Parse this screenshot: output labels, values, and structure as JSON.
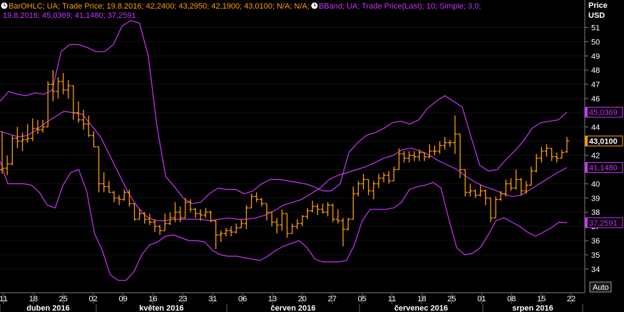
{
  "legend": {
    "ohlc": {
      "prefix": "BarOHLC; UA; Trade Price; 19.8.2016; 42,2400; 43,2950; 42,1900; 43,0100; N/A; N/A;",
      "color": "#ff9e00",
      "icon": "clock-icon"
    },
    "bband": {
      "line1": "BBand; UA; Trade Price(Last);  10; Simple; 3,0;",
      "line2": "19.8.2016; 45,0369; 41,1480; 37,2591",
      "color": "#cc33ff",
      "icon": "clock-icon"
    }
  },
  "axis": {
    "header_line1": "Price",
    "header_line2": "USD",
    "auto_label": "Auto"
  },
  "tags": [
    {
      "label": "45,0369",
      "value": 45.0369,
      "color": "#cc33ff",
      "text": "#cc33ff"
    },
    {
      "label": "43,0100",
      "value": 43.01,
      "color": "#ff9e00",
      "text": "#ffffff"
    },
    {
      "label": "41,1480",
      "value": 41.148,
      "color": "#cc33ff",
      "text": "#cc33ff"
    },
    {
      "label": "37,2591",
      "value": 37.2591,
      "color": "#cc33ff",
      "text": "#cc33ff"
    }
  ],
  "chart_data": {
    "type": "ohlc",
    "ylim": [
      33,
      52
    ],
    "y_ticks": [
      34,
      35,
      36,
      37,
      38,
      39,
      40,
      41,
      42,
      43,
      44,
      45,
      46,
      47,
      48,
      49,
      50,
      51
    ],
    "x_ticks": [
      "11",
      "18",
      "25",
      "02",
      "09",
      "16",
      "23",
      "31",
      "06",
      "13",
      "20",
      "27",
      "05",
      "11",
      "18",
      "25",
      "01",
      "08",
      "15",
      "22"
    ],
    "months": [
      "duben 2016",
      "květen 2016",
      "červen 2016",
      "červenec 2016",
      "srpen 2016"
    ],
    "bars": [
      {
        "o": 41.0,
        "h": 43.7,
        "l": 40.7,
        "c": 41.1
      },
      {
        "o": 41.1,
        "h": 42.0,
        "l": 40.6,
        "c": 41.4
      },
      {
        "o": 41.4,
        "h": 43.4,
        "l": 41.3,
        "c": 43.2
      },
      {
        "o": 43.2,
        "h": 44.0,
        "l": 42.5,
        "c": 43.0
      },
      {
        "o": 43.0,
        "h": 43.6,
        "l": 42.3,
        "c": 43.1
      },
      {
        "o": 43.1,
        "h": 44.2,
        "l": 42.9,
        "c": 43.2
      },
      {
        "o": 43.2,
        "h": 44.6,
        "l": 43.0,
        "c": 43.9
      },
      {
        "o": 43.9,
        "h": 44.5,
        "l": 43.5,
        "c": 43.8
      },
      {
        "o": 43.8,
        "h": 44.5,
        "l": 43.6,
        "c": 44.0
      },
      {
        "o": 44.0,
        "h": 47.2,
        "l": 44.7,
        "c": 47.0
      },
      {
        "o": 47.0,
        "h": 48.0,
        "l": 45.8,
        "c": 46.5
      },
      {
        "o": 46.5,
        "h": 47.5,
        "l": 46.0,
        "c": 47.2
      },
      {
        "o": 47.2,
        "h": 47.8,
        "l": 46.3,
        "c": 46.6
      },
      {
        "o": 46.6,
        "h": 47.3,
        "l": 46.0,
        "c": 46.9
      },
      {
        "o": 46.9,
        "h": 46.1,
        "l": 44.5,
        "c": 45.0
      },
      {
        "o": 45.0,
        "h": 45.8,
        "l": 44.3,
        "c": 44.5
      },
      {
        "o": 44.5,
        "h": 45.2,
        "l": 43.8,
        "c": 44.2
      },
      {
        "o": 44.2,
        "h": 44.8,
        "l": 43.3,
        "c": 43.4
      },
      {
        "o": 43.4,
        "h": 43.7,
        "l": 42.6,
        "c": 42.6
      },
      {
        "o": 42.6,
        "h": 41.6,
        "l": 39.4,
        "c": 40.0
      },
      {
        "o": 40.0,
        "h": 40.8,
        "l": 39.4,
        "c": 39.8
      },
      {
        "o": 39.8,
        "h": 40.2,
        "l": 39.4,
        "c": 39.4
      },
      {
        "o": 39.4,
        "h": 39.5,
        "l": 38.7,
        "c": 39.0
      },
      {
        "o": 39.0,
        "h": 39.2,
        "l": 38.5,
        "c": 38.9
      },
      {
        "o": 38.9,
        "h": 39.6,
        "l": 38.8,
        "c": 39.4
      },
      {
        "o": 39.4,
        "h": 39.6,
        "l": 38.4,
        "c": 38.6
      },
      {
        "o": 38.6,
        "h": 38.6,
        "l": 37.4,
        "c": 37.5
      },
      {
        "o": 37.5,
        "h": 38.2,
        "l": 37.5,
        "c": 37.9
      },
      {
        "o": 37.9,
        "h": 38.0,
        "l": 37.2,
        "c": 37.5
      },
      {
        "o": 37.5,
        "h": 37.9,
        "l": 37.1,
        "c": 37.3
      },
      {
        "o": 37.3,
        "h": 37.5,
        "l": 36.6,
        "c": 37.0
      },
      {
        "o": 37.0,
        "h": 37.1,
        "l": 36.4,
        "c": 36.7
      },
      {
        "o": 36.7,
        "h": 37.9,
        "l": 36.8,
        "c": 37.2
      },
      {
        "o": 37.2,
        "h": 38.0,
        "l": 37.1,
        "c": 37.6
      },
      {
        "o": 37.6,
        "h": 38.7,
        "l": 37.3,
        "c": 38.0
      },
      {
        "o": 38.0,
        "h": 38.4,
        "l": 37.3,
        "c": 37.6
      },
      {
        "o": 37.6,
        "h": 39.0,
        "l": 37.6,
        "c": 38.7
      },
      {
        "o": 38.7,
        "h": 38.9,
        "l": 38.0,
        "c": 38.2
      },
      {
        "o": 38.2,
        "h": 38.3,
        "l": 37.6,
        "c": 37.9
      },
      {
        "o": 37.9,
        "h": 38.2,
        "l": 37.4,
        "c": 37.8
      },
      {
        "o": 37.8,
        "h": 38.3,
        "l": 37.6,
        "c": 38.0
      },
      {
        "o": 38.0,
        "h": 38.1,
        "l": 37.3,
        "c": 37.4
      },
      {
        "o": 37.4,
        "h": 36.6,
        "l": 35.4,
        "c": 36.4
      },
      {
        "o": 36.4,
        "h": 36.7,
        "l": 35.9,
        "c": 36.5
      },
      {
        "o": 36.5,
        "h": 36.9,
        "l": 36.3,
        "c": 36.7
      },
      {
        "o": 36.7,
        "h": 37.0,
        "l": 36.3,
        "c": 36.6
      },
      {
        "o": 36.6,
        "h": 37.2,
        "l": 36.5,
        "c": 36.9
      },
      {
        "o": 36.9,
        "h": 37.5,
        "l": 36.9,
        "c": 37.2
      },
      {
        "o": 37.2,
        "h": 38.5,
        "l": 36.8,
        "c": 38.3
      },
      {
        "o": 38.3,
        "h": 39.3,
        "l": 38.5,
        "c": 39.1
      },
      {
        "o": 39.1,
        "h": 39.4,
        "l": 38.7,
        "c": 38.9
      },
      {
        "o": 38.9,
        "h": 39.0,
        "l": 38.4,
        "c": 38.6
      },
      {
        "o": 38.6,
        "h": 38.4,
        "l": 37.4,
        "c": 38.0
      },
      {
        "o": 38.0,
        "h": 37.8,
        "l": 37.0,
        "c": 37.3
      },
      {
        "o": 37.3,
        "h": 37.6,
        "l": 36.5,
        "c": 37.1
      },
      {
        "o": 37.1,
        "h": 38.2,
        "l": 36.7,
        "c": 37.9
      },
      {
        "o": 37.9,
        "h": 37.4,
        "l": 36.2,
        "c": 36.5
      },
      {
        "o": 36.5,
        "h": 37.2,
        "l": 36.5,
        "c": 37.0
      },
      {
        "o": 37.0,
        "h": 37.5,
        "l": 36.8,
        "c": 37.2
      },
      {
        "o": 37.2,
        "h": 37.8,
        "l": 37.0,
        "c": 37.7
      },
      {
        "o": 37.7,
        "h": 38.3,
        "l": 37.5,
        "c": 38.1
      },
      {
        "o": 38.1,
        "h": 38.8,
        "l": 38.0,
        "c": 38.4
      },
      {
        "o": 38.4,
        "h": 38.6,
        "l": 37.8,
        "c": 38.2
      },
      {
        "o": 38.2,
        "h": 38.6,
        "l": 37.9,
        "c": 38.0
      },
      {
        "o": 38.0,
        "h": 38.7,
        "l": 37.7,
        "c": 38.5
      },
      {
        "o": 38.5,
        "h": 38.6,
        "l": 37.3,
        "c": 37.5
      },
      {
        "o": 37.5,
        "h": 38.2,
        "l": 37.2,
        "c": 37.4
      },
      {
        "o": 37.4,
        "h": 37.6,
        "l": 35.6,
        "c": 36.8
      },
      {
        "o": 36.8,
        "h": 37.6,
        "l": 36.7,
        "c": 37.5
      },
      {
        "o": 37.5,
        "h": 39.8,
        "l": 38.4,
        "c": 39.3
      },
      {
        "o": 39.3,
        "h": 40.2,
        "l": 39.1,
        "c": 40.0
      },
      {
        "o": 40.0,
        "h": 40.7,
        "l": 39.6,
        "c": 40.3
      },
      {
        "o": 40.3,
        "h": 40.3,
        "l": 39.2,
        "c": 39.5
      },
      {
        "o": 39.5,
        "h": 40.2,
        "l": 38.9,
        "c": 40.0
      },
      {
        "o": 40.0,
        "h": 40.7,
        "l": 39.7,
        "c": 40.4
      },
      {
        "o": 40.4,
        "h": 40.8,
        "l": 40.1,
        "c": 40.6
      },
      {
        "o": 40.6,
        "h": 40.9,
        "l": 40.0,
        "c": 40.2
      },
      {
        "o": 40.2,
        "h": 41.2,
        "l": 40.3,
        "c": 41.0
      },
      {
        "o": 41.0,
        "h": 42.5,
        "l": 41.3,
        "c": 42.1
      },
      {
        "o": 42.1,
        "h": 42.3,
        "l": 41.5,
        "c": 41.8
      },
      {
        "o": 41.8,
        "h": 42.3,
        "l": 41.5,
        "c": 42.0
      },
      {
        "o": 42.0,
        "h": 42.3,
        "l": 41.6,
        "c": 41.9
      },
      {
        "o": 41.9,
        "h": 42.4,
        "l": 41.6,
        "c": 42.2
      },
      {
        "o": 42.2,
        "h": 42.2,
        "l": 41.6,
        "c": 41.9
      },
      {
        "o": 41.9,
        "h": 42.8,
        "l": 41.8,
        "c": 42.3
      },
      {
        "o": 42.3,
        "h": 42.7,
        "l": 42.0,
        "c": 42.3
      },
      {
        "o": 42.3,
        "h": 43.0,
        "l": 42.1,
        "c": 42.7
      },
      {
        "o": 42.7,
        "h": 43.3,
        "l": 42.4,
        "c": 42.9
      },
      {
        "o": 42.9,
        "h": 43.1,
        "l": 42.6,
        "c": 42.9
      },
      {
        "o": 42.9,
        "h": 44.8,
        "l": 42.1,
        "c": 43.5
      },
      {
        "o": 43.5,
        "h": 43.5,
        "l": 40.4,
        "c": 41.0
      },
      {
        "o": 41.0,
        "h": 40.5,
        "l": 39.1,
        "c": 39.4
      },
      {
        "o": 39.4,
        "h": 40.0,
        "l": 39.1,
        "c": 39.5
      },
      {
        "o": 39.5,
        "h": 39.6,
        "l": 39.0,
        "c": 39.2
      },
      {
        "o": 39.2,
        "h": 39.9,
        "l": 39.1,
        "c": 39.5
      },
      {
        "o": 39.5,
        "h": 39.6,
        "l": 38.5,
        "c": 39.0
      },
      {
        "o": 39.0,
        "h": 38.8,
        "l": 37.3,
        "c": 37.6
      },
      {
        "o": 37.6,
        "h": 39.1,
        "l": 38.5,
        "c": 38.9
      },
      {
        "o": 38.9,
        "h": 39.5,
        "l": 38.8,
        "c": 39.3
      },
      {
        "o": 39.3,
        "h": 40.3,
        "l": 39.1,
        "c": 40.0
      },
      {
        "o": 40.0,
        "h": 40.4,
        "l": 39.5,
        "c": 39.7
      },
      {
        "o": 39.7,
        "h": 41.0,
        "l": 39.6,
        "c": 40.3
      },
      {
        "o": 40.3,
        "h": 40.4,
        "l": 39.2,
        "c": 39.5
      },
      {
        "o": 39.5,
        "h": 40.2,
        "l": 39.3,
        "c": 39.9
      },
      {
        "o": 39.9,
        "h": 41.2,
        "l": 40.1,
        "c": 40.9
      },
      {
        "o": 40.9,
        "h": 42.1,
        "l": 40.8,
        "c": 41.8
      },
      {
        "o": 41.8,
        "h": 42.6,
        "l": 41.5,
        "c": 42.3
      },
      {
        "o": 42.3,
        "h": 42.8,
        "l": 41.9,
        "c": 42.5
      },
      {
        "o": 42.5,
        "h": 42.5,
        "l": 41.6,
        "c": 41.9
      },
      {
        "o": 41.9,
        "h": 42.2,
        "l": 41.5,
        "c": 41.8
      },
      {
        "o": 41.8,
        "h": 42.4,
        "l": 41.9,
        "c": 42.2
      },
      {
        "o": 42.24,
        "h": 43.295,
        "l": 42.19,
        "c": 43.01
      }
    ],
    "upper_band": [
      45.8,
      46.5,
      46.3,
      46.2,
      46.4,
      46.3,
      46.6,
      49.3,
      49.8,
      49.8,
      49.6,
      49.3,
      49.3,
      49.8,
      51.1,
      51.5,
      51.3,
      49.0,
      44.0,
      40.5,
      39.8,
      39.0,
      38.6,
      38.7,
      39.3,
      39.7,
      39.6,
      39.6,
      39.3,
      39.5,
      40.0,
      40.3,
      40.3,
      40.2,
      40.1,
      40.0,
      39.8,
      39.5,
      39.5,
      40.0,
      42.2,
      42.9,
      43.4,
      43.6,
      43.9,
      44.3,
      44.4,
      44.2,
      44.5,
      45.3,
      45.8,
      46.2,
      45.8,
      45.4,
      43.3,
      41.3,
      40.9,
      41.0,
      41.7,
      42.3,
      43.0,
      43.9,
      44.3,
      44.4,
      44.5,
      45.04
    ],
    "middle_band": [
      43.7,
      43.5,
      43.3,
      43.4,
      43.8,
      44.3,
      44.7,
      45.1,
      45.0,
      44.9,
      44.1,
      43.3,
      42.0,
      40.7,
      39.4,
      38.4,
      37.7,
      37.4,
      37.4,
      37.5,
      37.5,
      37.5,
      37.5,
      37.4,
      37.5,
      37.6,
      37.5,
      37.5,
      37.6,
      37.8,
      38.1,
      38.5,
      38.7,
      38.9,
      39.3,
      39.7,
      40.3,
      40.6,
      40.8,
      41.0,
      41.2,
      41.5,
      41.8,
      42.0,
      42.4,
      42.5,
      42.3,
      42.0,
      41.6,
      41.3,
      41.0,
      40.5,
      40.1,
      39.8,
      39.6,
      39.3,
      39.1,
      39.2,
      39.6,
      40.0,
      40.4,
      40.8,
      41.148
    ],
    "lower_band": [
      41.6,
      40.0,
      40.0,
      40.0,
      39.9,
      39.4,
      38.5,
      38.3,
      39.9,
      40.8,
      41.0,
      39.5,
      36.5,
      35.3,
      33.6,
      33.2,
      33.2,
      33.8,
      35.0,
      35.7,
      35.9,
      36.3,
      36.4,
      36.2,
      36.0,
      36.0,
      35.9,
      35.3,
      35.0,
      34.9,
      34.9,
      34.8,
      34.7,
      34.6,
      34.9,
      35.3,
      35.6,
      35.8,
      36.0,
      35.5,
      34.7,
      34.5,
      34.5,
      34.5,
      34.6,
      35.7,
      37.4,
      38.2,
      38.2,
      38.2,
      38.3,
      38.7,
      39.6,
      39.8,
      39.9,
      40.1,
      39.7,
      37.5,
      35.5,
      35.0,
      35.1,
      35.5,
      36.4,
      37.4,
      37.6,
      37.3,
      37.0,
      36.6,
      36.3,
      36.6,
      36.9,
      37.3,
      37.26
    ]
  }
}
